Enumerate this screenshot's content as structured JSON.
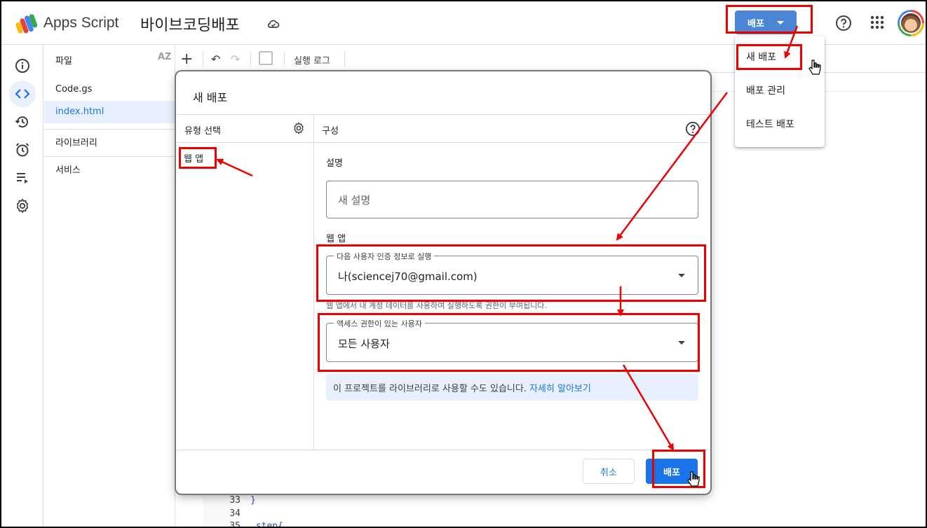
{
  "header": {
    "app_name": "Apps Script",
    "project_title": "바이브코딩배포",
    "deploy_label": "배포"
  },
  "files_panel": {
    "title": "파일",
    "sort_label": "AZ",
    "files": [
      "Code.gs",
      "index.html"
    ],
    "libraries_label": "라이브러리",
    "services_label": "서비스"
  },
  "toolbar": {
    "execution_log": "실행 로그"
  },
  "editor": {
    "lines": [
      {
        "num": "33",
        "code": "}"
      },
      {
        "num": "34",
        "code": ""
      },
      {
        "num": "35",
        "code": ".step{"
      }
    ]
  },
  "deploy_menu": {
    "items": [
      "새 배포",
      "배포 관리",
      "테스트 배포"
    ]
  },
  "dialog": {
    "title": "새 배포",
    "type_select_label": "유형 선택",
    "selected_type": "웹 앱",
    "config_label": "구성",
    "description_label": "설명",
    "description_placeholder": "새 설명",
    "webapp_section_label": "웹 앱",
    "execute_as_legend": "다음 사용자 인증 정보로 실행",
    "execute_as_value": "나(sciencej70@gmail.com)",
    "execute_as_help": "웹 앱에서 내 계정 데이터를 사용하여 실행하도록 권한이 부여됩니다.",
    "access_legend": "액세스 권한이 있는 사용자",
    "access_value": "모든 사용자",
    "info_text": "이 프로젝트를 라이브러리로 사용할 수도 있습니다.",
    "learn_more": "자세히 알아보기",
    "cancel_label": "취소",
    "confirm_label": "배포"
  },
  "colors": {
    "accent": "#1a73e8",
    "annotation": "#e00000",
    "deploy_button": "#4a86d4"
  }
}
